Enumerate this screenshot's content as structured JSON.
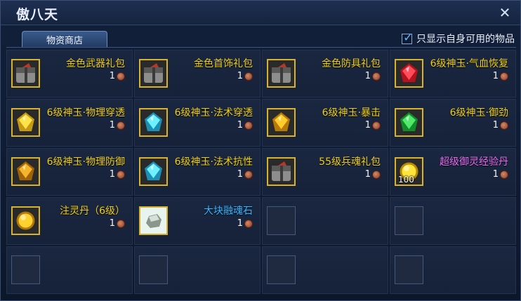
{
  "window": {
    "title": "傲八天"
  },
  "tab": {
    "label": "物资商店"
  },
  "filter": {
    "label": "只显示自身可用的物品",
    "checked": true
  },
  "items": [
    {
      "name": "金色武器礼包",
      "qty": "1",
      "icon": "gift-pack-icon",
      "color": "gold"
    },
    {
      "name": "金色首饰礼包",
      "qty": "1",
      "icon": "gift-pack-icon",
      "color": "gold"
    },
    {
      "name": "金色防具礼包",
      "qty": "1",
      "icon": "gift-pack-icon",
      "color": "gold"
    },
    {
      "name": "6级神玉·气血恢复",
      "qty": "1",
      "icon": "red-jade-icon",
      "color": "gold"
    },
    {
      "name": "6级神玉·物理穿透",
      "qty": "1",
      "icon": "yellow-jade-icon",
      "color": "gold"
    },
    {
      "name": "6级神玉·法术穿透",
      "qty": "1",
      "icon": "cyan-jade-icon",
      "color": "gold"
    },
    {
      "name": "6级神玉·暴击",
      "qty": "1",
      "icon": "gold-jade-icon",
      "color": "gold"
    },
    {
      "name": "6级神玉·御劲",
      "qty": "1",
      "icon": "green-jade-icon",
      "color": "gold"
    },
    {
      "name": "6级神玉·物理防御",
      "qty": "1",
      "icon": "amber-jade-icon",
      "color": "gold"
    },
    {
      "name": "6级神玉·法术抗性",
      "qty": "1",
      "icon": "cyan-jade-icon",
      "color": "gold"
    },
    {
      "name": "55级兵魂礼包",
      "qty": "1",
      "icon": "gift-pack-icon",
      "color": "gold"
    },
    {
      "name": "超级御灵经验丹",
      "qty": "1",
      "icon": "exp-pill-icon",
      "color": "purple",
      "stack": "100"
    },
    {
      "name": "注灵丹（6级）",
      "qty": "1",
      "icon": "spirit-pill-icon",
      "color": "gold"
    },
    {
      "name": "大块融魂石",
      "qty": "1",
      "icon": "soul-stone-icon",
      "color": "blue"
    }
  ],
  "colors": {
    "gold": "#f0cf1a",
    "blue": "#38b6ff",
    "purple": "#e66cf0"
  }
}
